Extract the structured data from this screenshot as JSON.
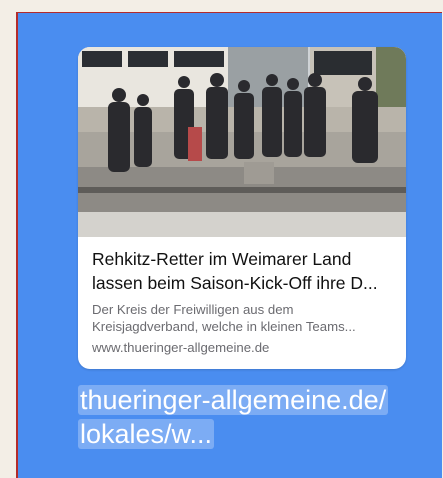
{
  "preview": {
    "image": "group-photo-outdoors",
    "title_line1": "Rehkitz-Retter im Weimarer Land",
    "title_line2": "lassen beim Saison-Kick-Off ihre D...",
    "description_line1": "Der Kreis der Freiwilligen aus dem",
    "description_line2": "Kreisjagdverband, welche in kleinen Teams...",
    "domain": "www.thueringer-allgemeine.de"
  },
  "message": {
    "link_line1": "thueringer-allgemeine.de/",
    "link_line2": "lokales/w..."
  },
  "colors": {
    "bubble": "#4a8df0",
    "card_bg": "#ffffff",
    "accent_border": "#b32b2b"
  }
}
